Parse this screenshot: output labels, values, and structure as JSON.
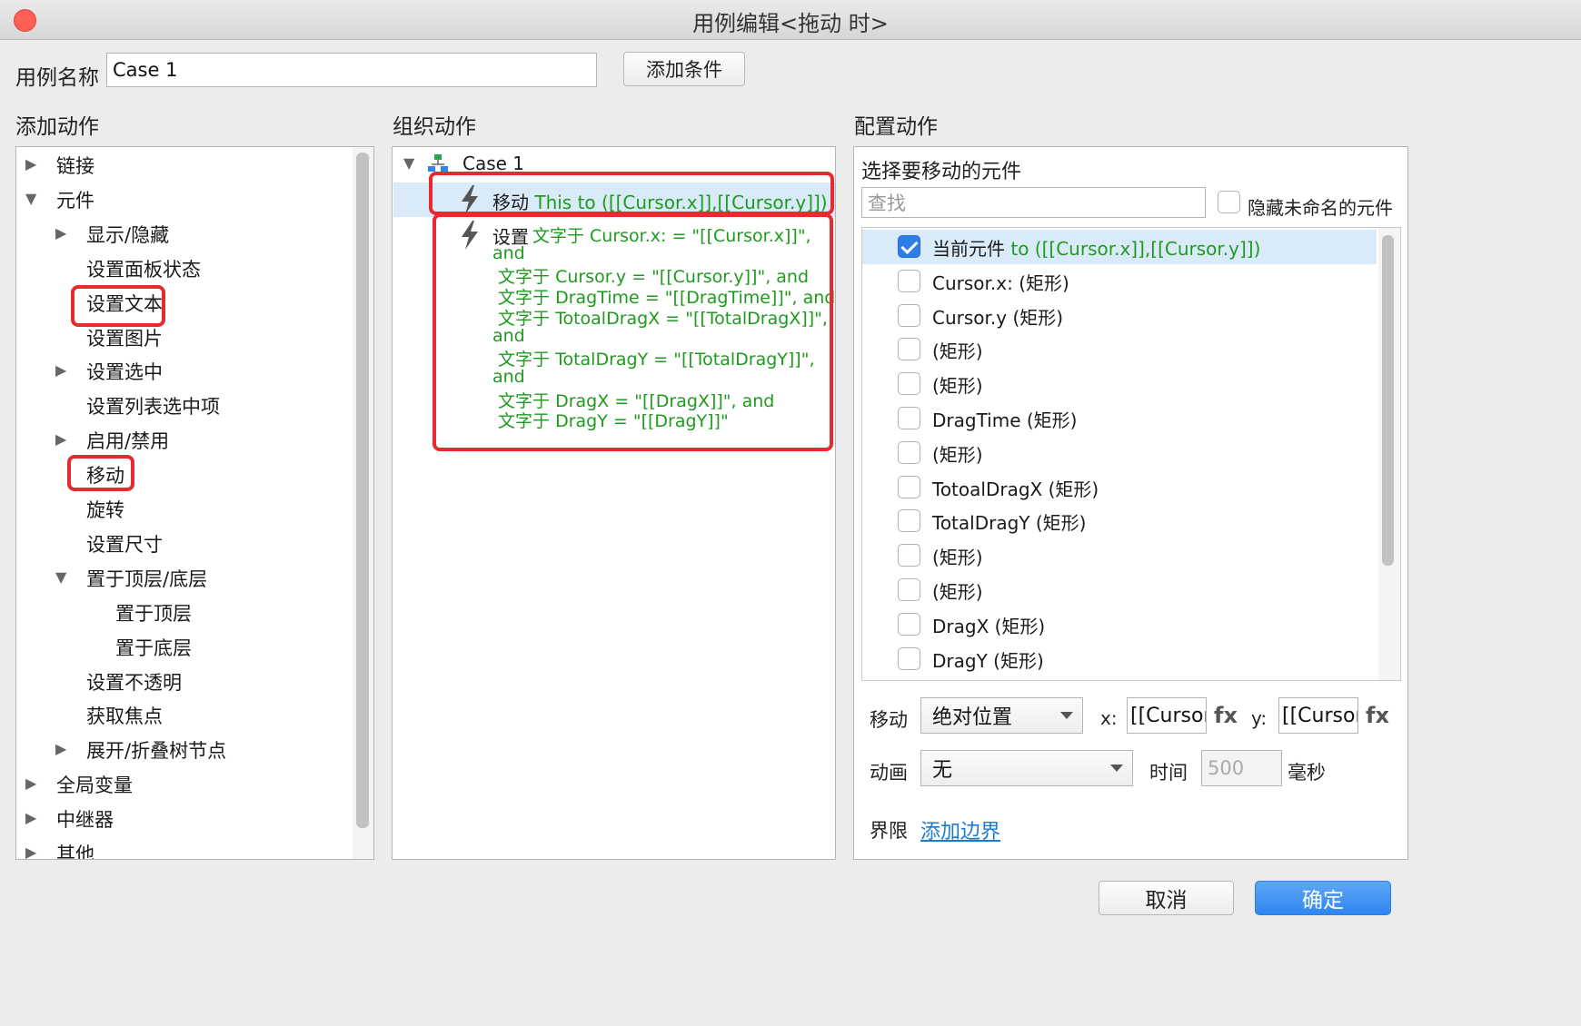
{
  "window": {
    "title": "用例编辑<拖动 时>"
  },
  "case_name": {
    "label": "用例名称",
    "value": "Case 1",
    "add_condition": "添加条件"
  },
  "add_actions": {
    "heading": "添加动作",
    "items": [
      {
        "label": "链接",
        "level": 0,
        "toggle": "collapsed"
      },
      {
        "label": "元件",
        "level": 0,
        "toggle": "expanded"
      },
      {
        "label": "显示/隐藏",
        "level": 1,
        "toggle": "collapsed"
      },
      {
        "label": "设置面板状态",
        "level": 1,
        "toggle": "none"
      },
      {
        "label": "设置文本",
        "level": 1,
        "toggle": "none",
        "highlighted": true
      },
      {
        "label": "设置图片",
        "level": 1,
        "toggle": "none"
      },
      {
        "label": "设置选中",
        "level": 1,
        "toggle": "collapsed"
      },
      {
        "label": "设置列表选中项",
        "level": 1,
        "toggle": "none"
      },
      {
        "label": "启用/禁用",
        "level": 1,
        "toggle": "collapsed"
      },
      {
        "label": "移动",
        "level": 1,
        "toggle": "none",
        "highlighted": true
      },
      {
        "label": "旋转",
        "level": 1,
        "toggle": "none"
      },
      {
        "label": "设置尺寸",
        "level": 1,
        "toggle": "none"
      },
      {
        "label": "置于顶层/底层",
        "level": 1,
        "toggle": "expanded"
      },
      {
        "label": "置于顶层",
        "level": 2,
        "toggle": "none"
      },
      {
        "label": "置于底层",
        "level": 2,
        "toggle": "none"
      },
      {
        "label": "设置不透明",
        "level": 1,
        "toggle": "none"
      },
      {
        "label": "获取焦点",
        "level": 1,
        "toggle": "none"
      },
      {
        "label": "展开/折叠树节点",
        "level": 1,
        "toggle": "collapsed"
      },
      {
        "label": "全局变量",
        "level": 0,
        "toggle": "collapsed"
      },
      {
        "label": "中继器",
        "level": 0,
        "toggle": "collapsed"
      },
      {
        "label": "其他",
        "level": 0,
        "toggle": "collapsed"
      }
    ]
  },
  "organize": {
    "heading": "组织动作",
    "case_label": "Case 1",
    "move_action": {
      "verb": "移动",
      "detail": "This to ([[Cursor.x]],[[Cursor.y]])"
    },
    "set_action": {
      "verb": "设置",
      "lines": [
        "文字于 Cursor.x: = \"[[Cursor.x]]\",",
        "and",
        " 文字于 Cursor.y = \"[[Cursor.y]]\", and",
        " 文字于 DragTime = \"[[DragTime]]\", and",
        " 文字于 TotoalDragX = \"[[TotalDragX]]\",",
        "and",
        " 文字于 TotalDragY = \"[[TotalDragY]]\",",
        "and",
        " 文字于 DragX = \"[[DragX]]\", and",
        " 文字于 DragY = \"[[DragY]]\""
      ]
    }
  },
  "configure": {
    "heading": "配置动作",
    "select_label": "选择要移动的元件",
    "search_placeholder": "查找",
    "hide_unnamed": "隐藏未命名的元件",
    "widgets": [
      {
        "name": "当前元件",
        "suffix": " to ([[Cursor.x]],[[Cursor.y]])",
        "checked": true
      },
      {
        "name": "Cursor.x: (矩形)",
        "suffix": "",
        "checked": false
      },
      {
        "name": "Cursor.y (矩形)",
        "suffix": "",
        "checked": false
      },
      {
        "name": "(矩形)",
        "suffix": "",
        "checked": false
      },
      {
        "name": "(矩形)",
        "suffix": "",
        "checked": false
      },
      {
        "name": "DragTime (矩形)",
        "suffix": "",
        "checked": false
      },
      {
        "name": "(矩形)",
        "suffix": "",
        "checked": false
      },
      {
        "name": "TotoalDragX (矩形)",
        "suffix": "",
        "checked": false
      },
      {
        "name": "TotalDragY (矩形)",
        "suffix": "",
        "checked": false
      },
      {
        "name": "(矩形)",
        "suffix": "",
        "checked": false
      },
      {
        "name": "(矩形)",
        "suffix": "",
        "checked": false
      },
      {
        "name": "DragX (矩形)",
        "suffix": "",
        "checked": false
      },
      {
        "name": "DragY (矩形)",
        "suffix": "",
        "checked": false
      }
    ],
    "move_label": "移动",
    "move_mode": "绝对位置",
    "x_label": "x:",
    "x_value": "[[Cursor",
    "y_label": "y:",
    "y_value": "[[Cursor",
    "fx_label": "fx",
    "anim_label": "动画",
    "anim_value": "无",
    "time_label": "时间",
    "time_value": "500",
    "time_unit": "毫秒",
    "bound_label": "界限",
    "bound_link": "添加边界"
  },
  "footer": {
    "cancel": "取消",
    "ok": "确定"
  },
  "colors": {
    "highlight_red": "#e8292f",
    "action_green": "#1f9a1f",
    "selection_blue": "#d9ebf9",
    "primary_blue": "#2f86f0"
  }
}
